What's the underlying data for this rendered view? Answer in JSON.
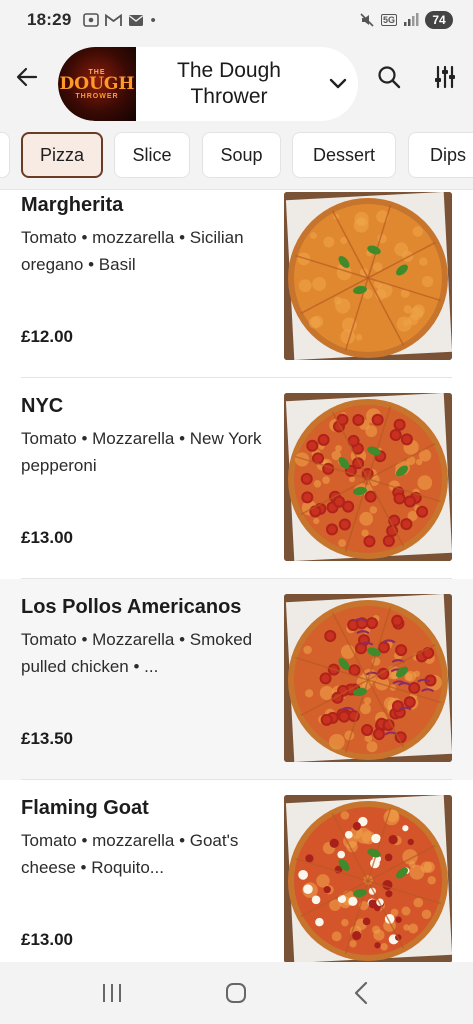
{
  "status": {
    "time": "18:29",
    "battery": "74",
    "network": "5G"
  },
  "header": {
    "store_name": "The Dough Thrower",
    "logo_top": "THE",
    "logo_main": "DOUGH",
    "logo_sub": "THROWER"
  },
  "tabs": [
    {
      "label": ""
    },
    {
      "label": "Pizza",
      "active": true
    },
    {
      "label": "Slice"
    },
    {
      "label": "Soup"
    },
    {
      "label": "Dessert"
    },
    {
      "label": "Dips"
    }
  ],
  "items": [
    {
      "name": "Margherita",
      "desc": "Tomato • mozzarella • Sicilian oregano • Basil",
      "price": "£12.00",
      "topping": "margherita"
    },
    {
      "name": "NYC",
      "desc": "Tomato • Mozzarella • New York pepperoni",
      "price": "£13.00",
      "topping": "pepperoni"
    },
    {
      "name": "Los Pollos Americanos",
      "desc": "Tomato • Mozzarella • Smoked pulled chicken • ...",
      "price": "£13.50",
      "topping": "chicken"
    },
    {
      "name": "Flaming Goat",
      "desc": "Tomato • mozzarella • Goat's cheese • Roquito...",
      "price": "£13.00",
      "topping": "goat"
    }
  ],
  "colors": {
    "accent": "#6b3b26",
    "active_tab_bg": "#f7ebe4",
    "background": "#f3f3f3"
  },
  "icons": [
    "back-arrow-icon",
    "chevron-down-icon",
    "search-icon",
    "filter-icon",
    "recents-icon",
    "home-icon",
    "back-nav-icon"
  ]
}
